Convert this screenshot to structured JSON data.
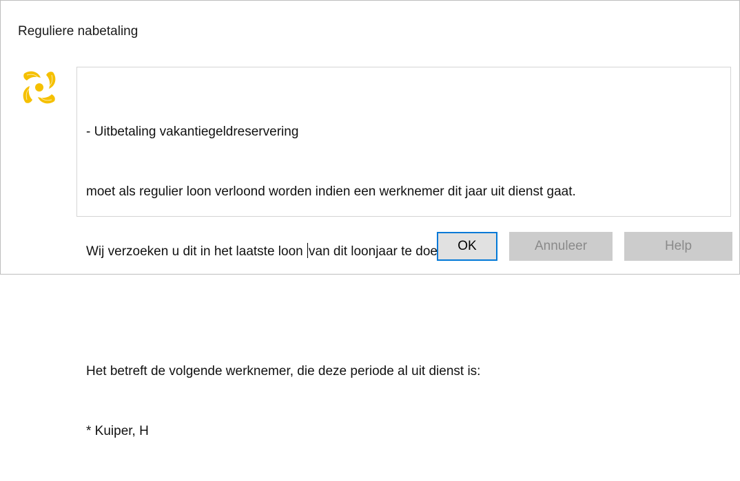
{
  "dialog": {
    "title": "Reguliere nabetaling",
    "logo_icon": "yellow-spiral-logo-icon",
    "message": {
      "line1": "- Uitbetaling vakantiegeldreservering",
      "line2": "moet als regulier loon verloond worden indien een werknemer dit jaar uit dienst gaat.",
      "line3_before_caret": "Wij verzoeken u dit in het laatste loon ",
      "line3_after_caret": "van dit loonjaar te doen.",
      "line4": "",
      "line5": "Het betreft de volgende werknemer, die deze periode al uit dienst is:",
      "line6": "* Kuiper, H"
    },
    "buttons": {
      "ok_label": "OK",
      "cancel_label": "Annuleer",
      "help_label": "Help"
    },
    "colors": {
      "logo": "#f5c000",
      "focus_border": "#0078d7",
      "disabled_bg": "#cccccc"
    }
  }
}
